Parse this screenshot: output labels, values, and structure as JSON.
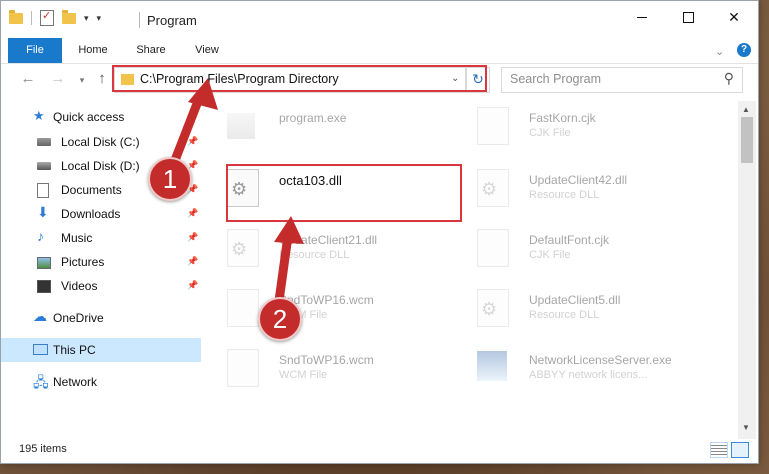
{
  "window": {
    "title": "Program",
    "status_count": "195 items"
  },
  "ribbon": {
    "file": "File",
    "home": "Home",
    "share": "Share",
    "view": "View",
    "help": "?"
  },
  "addressbar": {
    "path": "C:\\Program Files\\Program Directory",
    "search_placeholder": "Search Program"
  },
  "sidebar": {
    "quick_access": "Quick access",
    "items": [
      {
        "label": "Local Disk (C:)",
        "icon": "drive-icon"
      },
      {
        "label": "Local Disk (D:)",
        "icon": "drive-icon"
      },
      {
        "label": "Documents",
        "icon": "document-icon"
      },
      {
        "label": "Downloads",
        "icon": "download-icon"
      },
      {
        "label": "Music",
        "icon": "music-icon"
      },
      {
        "label": "Pictures",
        "icon": "pictures-icon"
      },
      {
        "label": "Videos",
        "icon": "videos-icon"
      }
    ],
    "onedrive": "OneDrive",
    "this_pc": "This PC",
    "network": "Network"
  },
  "files": [
    {
      "name": "program.exe",
      "type": ""
    },
    {
      "name": "FastKorn.cjk",
      "type": "CJK File"
    },
    {
      "name": "octa103.dll",
      "type": ""
    },
    {
      "name": "UpdateClient42.dll",
      "type": "Resource DLL"
    },
    {
      "name": "UpdateClient21.dll",
      "type": "Resource DLL"
    },
    {
      "name": "DefaultFont.cjk",
      "type": "CJK File"
    },
    {
      "name": "SndToWP16.wcm",
      "type": "WCM File"
    },
    {
      "name": "UpdateClient5.dll",
      "type": "Resource DLL"
    },
    {
      "name": "SndToWP16.wcm",
      "type": "WCM File"
    },
    {
      "name": "NetworkLicenseServer.exe",
      "type": "ABBYY network licens..."
    }
  ],
  "annotations": {
    "step1": "1",
    "step2": "2"
  },
  "colors": {
    "accent": "#1979ca",
    "highlight_red": "#d9363e",
    "selected_nav": "#cce8ff"
  }
}
